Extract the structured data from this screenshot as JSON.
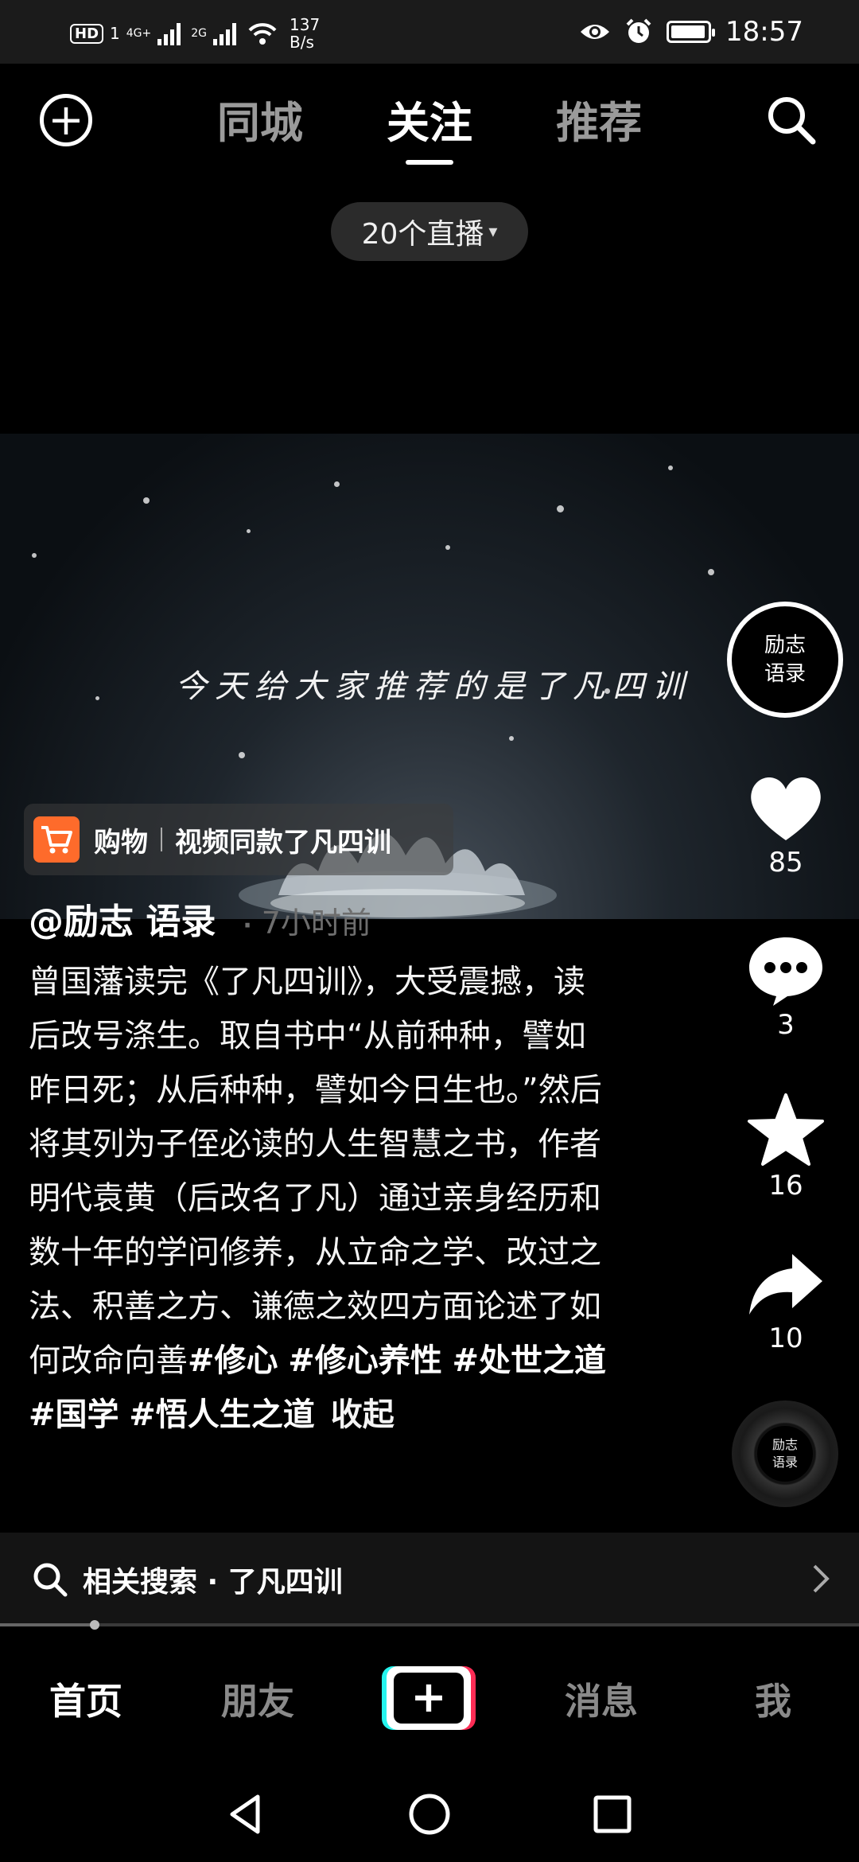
{
  "status_bar": {
    "hd": "HD",
    "sim": "1",
    "net1": "4G+",
    "net2": "2G",
    "speed_value": "137",
    "speed_unit": "B/s",
    "time": "18:57",
    "icons": [
      "eye-icon",
      "alarm-icon",
      "battery-icon"
    ],
    "battery_level": 0.95
  },
  "top_nav": {
    "tabs": [
      {
        "label": "同城",
        "active": false
      },
      {
        "label": "关注",
        "active": true
      },
      {
        "label": "推荐",
        "active": false
      }
    ],
    "add_icon": "plus-circle-icon",
    "search_icon": "search-icon"
  },
  "live_pill": {
    "label": "20个直播",
    "caret": "▾"
  },
  "video": {
    "caption": "今天给大家推荐的是了凡四训"
  },
  "shop_tag": {
    "label": "购物",
    "title": "视频同款了凡四训"
  },
  "author": {
    "handle": "@励志 语录",
    "separator": "·",
    "time": "7小时前"
  },
  "description": {
    "text": "曾国藩读完《了凡四训》，大受震撼，读后改号涤生。取自书中“从前种种，譬如昨日死；从后种种，譬如今日生也。”然后将其列为子侄必读的人生智慧之书，作者明代袁黄（后改名了凡）通过亲身经历和数十年的学问修养，从立命之学、改过之法、积善之方、谦德之效四方面论述了如何改命向善",
    "hashtags": [
      "#修心",
      "#修心养性",
      "#处世之道",
      "#国学",
      "#悟人生之道"
    ],
    "collapse": "收起"
  },
  "rail": {
    "avatar_line1": "励志",
    "avatar_line2": "语录",
    "likes": "85",
    "comments": "3",
    "favorites": "16",
    "shares": "10",
    "disc_line1": "励志",
    "disc_line2": "语录"
  },
  "related": {
    "text": "相关搜索 · 了凡四训"
  },
  "playback": {
    "progress": 0.11
  },
  "bottom_nav": {
    "home": "首页",
    "friends": "朋友",
    "plus": "+",
    "messages": "消息",
    "me": "我"
  },
  "colors": {
    "background": "#000000",
    "shop_orange": "#fe6b2b",
    "plus_cyan": "#25f4ee",
    "plus_red": "#fe2c55",
    "muted": "#9a9a9a"
  }
}
